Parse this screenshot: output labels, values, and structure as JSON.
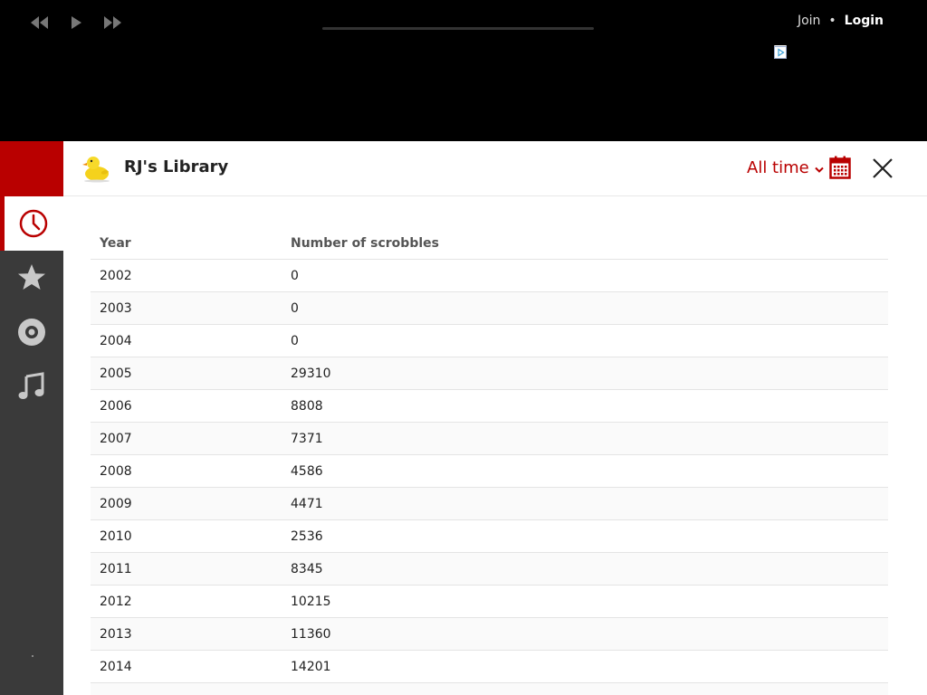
{
  "auth": {
    "join": "Join",
    "separator": "•",
    "login": "Login"
  },
  "library": {
    "title": "RJ's Library",
    "range": "All time"
  },
  "table": {
    "headers": [
      "Year",
      "Number of scrobbles"
    ],
    "rows": [
      [
        "2002",
        "0"
      ],
      [
        "2003",
        "0"
      ],
      [
        "2004",
        "0"
      ],
      [
        "2005",
        "29310"
      ],
      [
        "2006",
        "8808"
      ],
      [
        "2007",
        "7371"
      ],
      [
        "2008",
        "4586"
      ],
      [
        "2009",
        "4471"
      ],
      [
        "2010",
        "2536"
      ],
      [
        "2011",
        "8345"
      ],
      [
        "2012",
        "10215"
      ],
      [
        "2013",
        "11360"
      ],
      [
        "2014",
        "14201"
      ],
      [
        "",
        ""
      ]
    ]
  },
  "sidebar": {
    "items": [
      {
        "icon": "clock-icon",
        "active": true
      },
      {
        "icon": "star-icon",
        "active": false
      },
      {
        "icon": "disc-icon",
        "active": false
      },
      {
        "icon": "music-note-icon",
        "active": false
      }
    ]
  },
  "colors": {
    "accent": "#b90000",
    "sidebar": "#3a3a3a",
    "player": "#000000"
  }
}
